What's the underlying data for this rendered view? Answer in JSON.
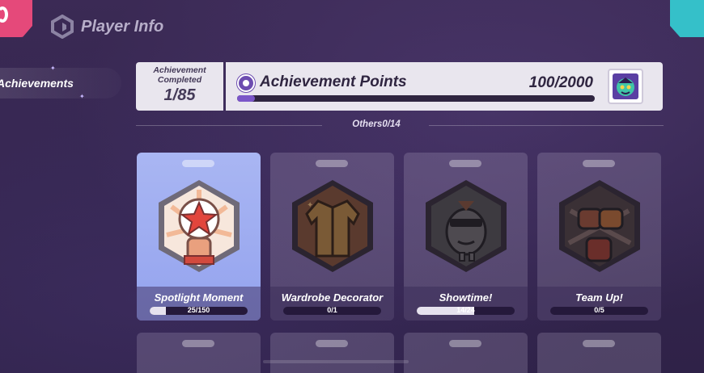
{
  "header": {
    "title": "Player Info"
  },
  "sidebar": {
    "items": [
      {
        "label": "Achievements"
      }
    ]
  },
  "summary": {
    "completed_label": "Achievement Completed",
    "completed_value": "1/85",
    "points_label": "Achievement Points",
    "points_value": "100/2000",
    "points_progress": 0.05
  },
  "section": {
    "title": "Others0/14"
  },
  "achievements": [
    {
      "name": "Spotlight Moment",
      "progress_text": "25/150",
      "progress": 0.1667,
      "active": true,
      "icon": "star-fist-icon"
    },
    {
      "name": "Wardrobe Decorator",
      "progress_text": "0/1",
      "progress": 0,
      "active": false,
      "icon": "jacket-icon"
    },
    {
      "name": "Showtime!",
      "progress_text": "14/24",
      "progress": 0.5833,
      "active": false,
      "icon": "sunglasses-character-icon"
    },
    {
      "name": "Team Up!",
      "progress_text": "0/5",
      "progress": 0,
      "active": false,
      "icon": "fist-bump-icon"
    }
  ],
  "colors": {
    "accent": "#7b56c8",
    "active_card": "#a9b6f3",
    "corner_left": "#e5497a",
    "corner_right": "#35c0c9"
  }
}
